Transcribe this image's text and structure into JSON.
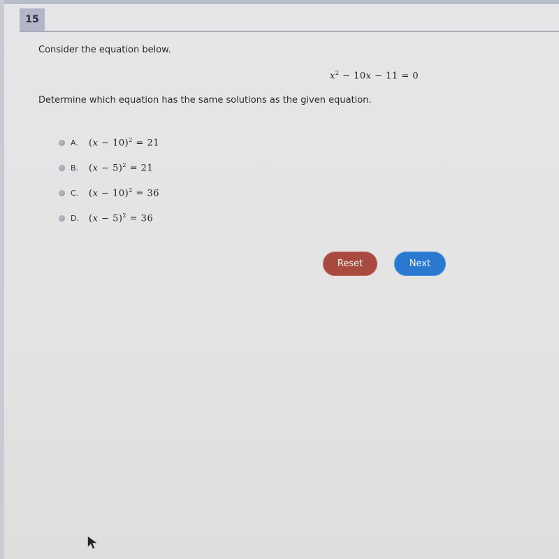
{
  "question": {
    "number": "15",
    "prompt": "Consider the equation below.",
    "given_equation": {
      "parts": [
        "x",
        "2",
        " − 10",
        "x",
        " − 11 = 0"
      ],
      "text": "x² − 10x − 11 = 0"
    },
    "instruction": "Determine which equation has the same solutions as the given equation."
  },
  "choices": [
    {
      "letter": "A.",
      "lhs_var": "x",
      "lhs_rest": " − 10)",
      "exponent": "2",
      "rhs": " = 21",
      "selected": false
    },
    {
      "letter": "B.",
      "lhs_var": "x",
      "lhs_rest": " − 5)",
      "exponent": "2",
      "rhs": " = 21",
      "selected": false
    },
    {
      "letter": "C.",
      "lhs_var": "x",
      "lhs_rest": " − 10)",
      "exponent": "2",
      "rhs": " = 36",
      "selected": false
    },
    {
      "letter": "D.",
      "lhs_var": "x",
      "lhs_rest": " − 5)",
      "exponent": "2",
      "rhs": " = 36",
      "selected": false
    }
  ],
  "buttons": {
    "reset_label": "Reset",
    "next_label": "Next"
  },
  "colors": {
    "reset": "#a84a3f",
    "next": "#2a78cf",
    "question_badge": "#b2b6c8"
  },
  "icons": {
    "cursor": "mouse-pointer-arrow"
  }
}
